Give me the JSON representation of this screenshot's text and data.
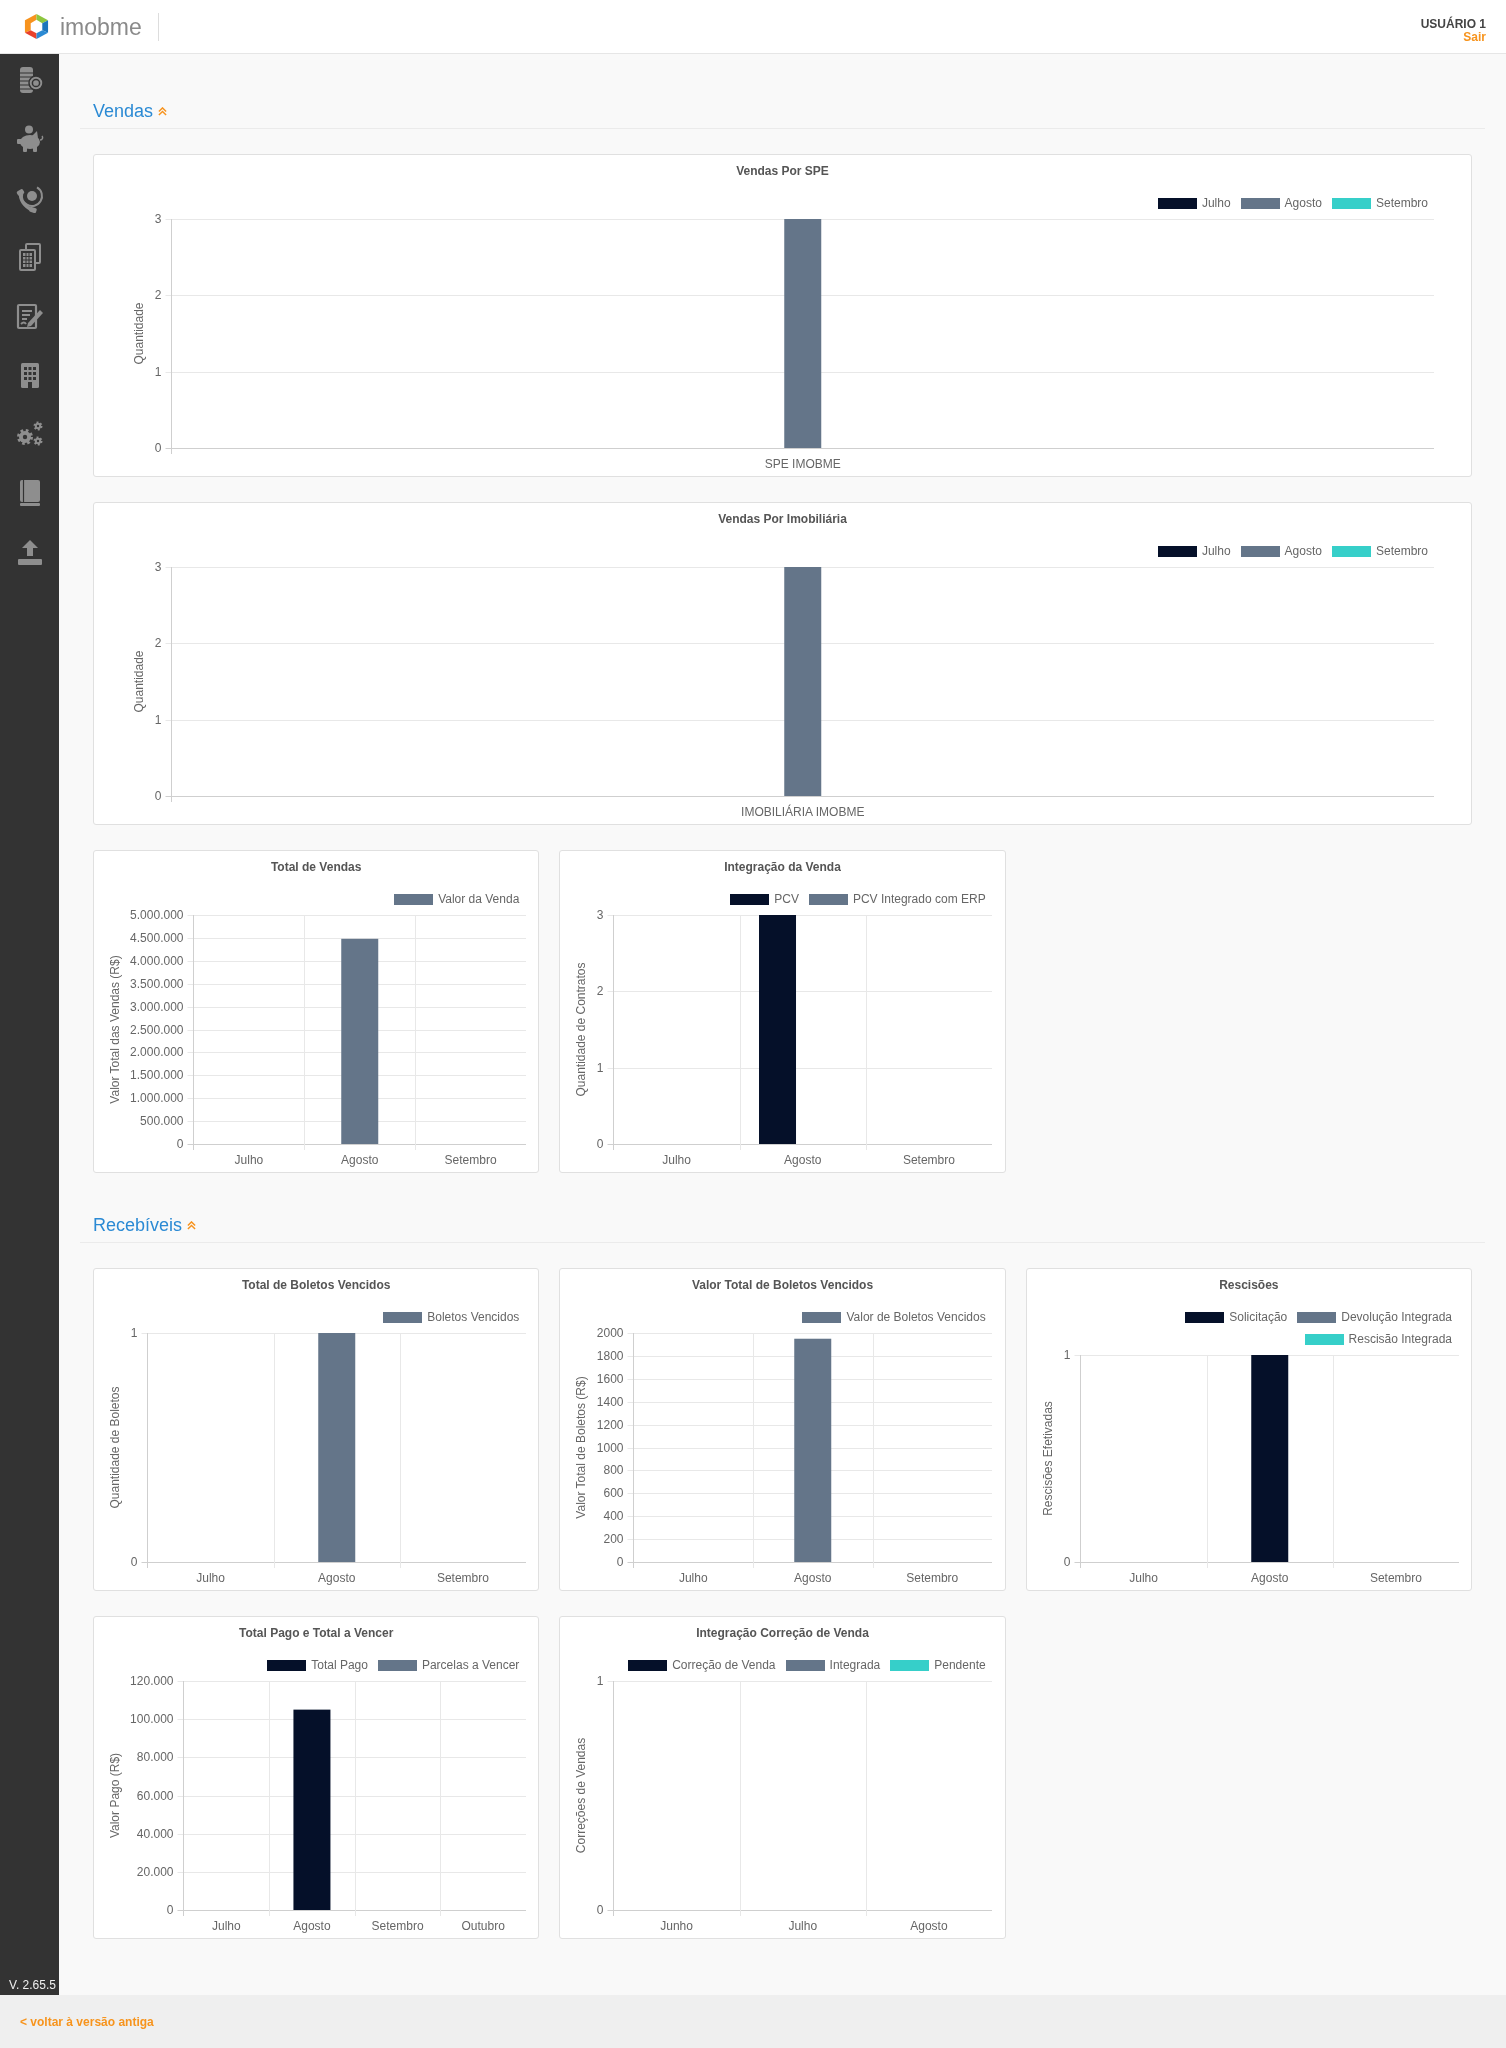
{
  "header": {
    "logo_text": "imobme",
    "user_name": "USUÁRIO 1",
    "logout_link": "Sair"
  },
  "sidebar": {
    "version": "V. 2.65.5"
  },
  "sections": [
    {
      "title": "Vendas",
      "expanded": true,
      "rows": [
        [
          {
            "chart_data": {
              "type": "bar",
              "title": "Vendas Por SPE",
              "ylabel": "Quantidade",
              "categories": [
                "SPE IMOBME"
              ],
              "series": [
                {
                  "name": "Julho",
                  "color": "#051029",
                  "values": [
                    0
                  ]
                },
                {
                  "name": "Agosto",
                  "color": "#647589",
                  "values": [
                    3
                  ]
                },
                {
                  "name": "Setembro",
                  "color": "#36cfc9",
                  "values": [
                    0
                  ]
                }
              ],
              "ylim": [
                0,
                3
              ],
              "yticks": [
                0,
                1,
                2,
                3
              ],
              "grid": true
            }
          }
        ],
        [
          {
            "chart_data": {
              "type": "bar",
              "title": "Vendas Por Imobiliária",
              "ylabel": "Quantidade",
              "categories": [
                "IMOBILIÁRIA IMOBME"
              ],
              "series": [
                {
                  "name": "Julho",
                  "color": "#051029",
                  "values": [
                    0
                  ]
                },
                {
                  "name": "Agosto",
                  "color": "#647589",
                  "values": [
                    3
                  ]
                },
                {
                  "name": "Setembro",
                  "color": "#36cfc9",
                  "values": [
                    0
                  ]
                }
              ],
              "ylim": [
                0,
                3
              ],
              "yticks": [
                0,
                1,
                2,
                3
              ],
              "grid": true
            }
          }
        ],
        [
          {
            "chart_data": {
              "type": "bar",
              "title": "Total de Vendas",
              "ylabel": "Valor Total das Vendas (R$)",
              "categories": [
                "Julho",
                "Agosto",
                "Setembro"
              ],
              "series": [
                {
                  "name": "Valor da Venda",
                  "color": "#647589",
                  "values": [
                    0,
                    4480000,
                    0
                  ]
                }
              ],
              "ylim": [
                0,
                5000000
              ],
              "yticks": [
                0,
                {
                  "value": 500000,
                  "label": "500.000"
                },
                {
                  "value": 1000000,
                  "label": "1.000.000"
                },
                {
                  "value": 1500000,
                  "label": "1.500.000"
                },
                {
                  "value": 2000000,
                  "label": "2.000.000"
                },
                {
                  "value": 2500000,
                  "label": "2.500.000"
                },
                {
                  "value": 3000000,
                  "label": "3.000.000"
                },
                {
                  "value": 3500000,
                  "label": "3.500.000"
                },
                {
                  "value": 4000000,
                  "label": "4.000.000"
                },
                {
                  "value": 4500000,
                  "label": "4.500.000"
                },
                {
                  "value": 5000000,
                  "label": "5.000.000"
                }
              ],
              "grid": true
            }
          },
          {
            "chart_data": {
              "type": "bar",
              "title": "Integração da Venda",
              "ylabel": "Quantidade de Contratos",
              "categories": [
                "Julho",
                "Agosto",
                "Setembro"
              ],
              "series": [
                {
                  "name": "PCV",
                  "color": "#051029",
                  "values": [
                    0,
                    3,
                    0
                  ]
                },
                {
                  "name": "PCV Integrado com ERP",
                  "color": "#647589",
                  "values": [
                    0,
                    0,
                    0
                  ]
                }
              ],
              "stacked": false,
              "ylim": [
                0,
                3
              ],
              "yticks": [
                0,
                1,
                2,
                3
              ],
              "grid": true
            }
          }
        ]
      ]
    },
    {
      "title": "Recebíveis",
      "expanded": true,
      "rows": [
        [
          {
            "chart_data": {
              "type": "bar",
              "title": "Total de Boletos Vencidos",
              "ylabel": "Quantidade de Boletos",
              "categories": [
                "Julho",
                "Agosto",
                "Setembro"
              ],
              "series": [
                {
                  "name": "Boletos Vencidos",
                  "color": "#647589",
                  "values": [
                    0,
                    1,
                    0
                  ]
                }
              ],
              "ylim": [
                0,
                1
              ],
              "yticks": [
                0,
                1
              ],
              "grid": true
            }
          },
          {
            "chart_data": {
              "type": "bar",
              "title": "Valor Total de Boletos Vencidos",
              "ylabel": "Valor Total de Boletos (R$)",
              "categories": [
                "Julho",
                "Agosto",
                "Setembro"
              ],
              "series": [
                {
                  "name": "Valor de Boletos Vencidos",
                  "color": "#647589",
                  "values": [
                    0,
                    1950,
                    0
                  ]
                }
              ],
              "ylim": [
                0,
                2000
              ],
              "yticks": [
                0,
                200,
                400,
                600,
                800,
                1000,
                1200,
                1400,
                1600,
                1800,
                2000
              ],
              "grid": true
            }
          },
          {
            "chart_data": {
              "type": "bar",
              "title": "Rescisões",
              "ylabel": "Rescisões Efetivadas",
              "categories": [
                "Julho",
                "Agosto",
                "Setembro"
              ],
              "series": [
                {
                  "name": "Solicitação",
                  "color": "#051029",
                  "values": [
                    0,
                    1,
                    0
                  ]
                },
                {
                  "name": "Devolução Integrada",
                  "color": "#647589",
                  "values": [
                    0,
                    0,
                    0
                  ]
                },
                {
                  "name": "Rescisão Integrada",
                  "color": "#36cfc9",
                  "values": [
                    0,
                    0,
                    0
                  ]
                }
              ],
              "stacked": true,
              "ylim": [
                0,
                1
              ],
              "yticks": [
                0,
                1
              ],
              "grid": true
            }
          }
        ],
        [
          {
            "chart_data": {
              "type": "bar",
              "title": "Total Pago e Total a Vencer",
              "ylabel": "Valor Pago (R$)",
              "categories": [
                "Julho",
                "Agosto",
                "Setembro",
                "Outubro"
              ],
              "series": [
                {
                  "name": "Total Pago",
                  "color": "#051029",
                  "values": [
                    0,
                    105000,
                    0,
                    0
                  ]
                },
                {
                  "name": "Parcelas a Vencer",
                  "color": "#647589",
                  "values": [
                    0,
                    0,
                    0,
                    0
                  ]
                }
              ],
              "stacked": true,
              "ylim": [
                0,
                120000
              ],
              "yticks": [
                0,
                {
                  "value": 20000,
                  "label": "20.000"
                },
                {
                  "value": 40000,
                  "label": "40.000"
                },
                {
                  "value": 60000,
                  "label": "60.000"
                },
                {
                  "value": 80000,
                  "label": "80.000"
                },
                {
                  "value": 100000,
                  "label": "100.000"
                },
                {
                  "value": 120000,
                  "label": "120.000"
                }
              ],
              "grid": true
            }
          },
          {
            "chart_data": {
              "type": "bar",
              "title": "Integração Correção de Venda",
              "ylabel": "Correções de Vendas",
              "categories": [
                "Junho",
                "Julho",
                "Agosto"
              ],
              "series": [
                {
                  "name": "Correção de Venda",
                  "color": "#051029",
                  "values": [
                    0,
                    0,
                    0
                  ]
                },
                {
                  "name": "Integrada",
                  "color": "#647589",
                  "values": [
                    0,
                    0,
                    0
                  ]
                },
                {
                  "name": "Pendente",
                  "color": "#36cfc9",
                  "values": [
                    0,
                    0,
                    0
                  ]
                }
              ],
              "ylim": [
                0,
                1
              ],
              "yticks": [
                0,
                1
              ],
              "grid": true
            }
          }
        ]
      ]
    }
  ],
  "footer": {
    "back_link": "< voltar à versão antiga"
  }
}
